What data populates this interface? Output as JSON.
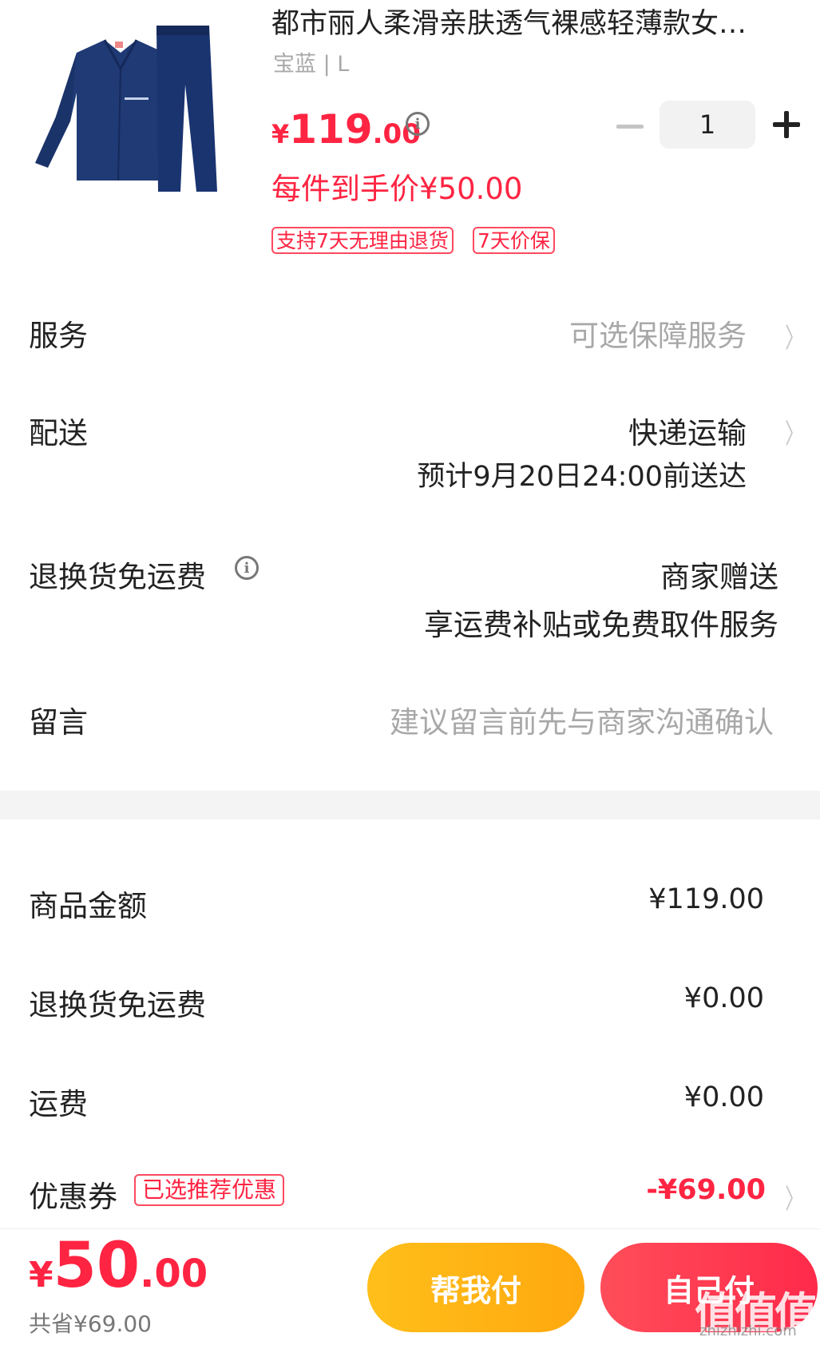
{
  "product": {
    "title": "都市丽人柔滑亲肤透气裸感轻薄款女…",
    "variant": "宝蓝 | L",
    "price_symbol": "¥",
    "price_int": "119",
    "price_dec": ".00",
    "per_unit": "每件到手价¥50.00",
    "quantity": "1",
    "tags": [
      "支持7天无理由退货",
      "7天价保"
    ],
    "image_colors": {
      "garment": "#1f3a75",
      "garment_dark": "#15295a",
      "trim": "#c7d3ea"
    }
  },
  "rows": {
    "service": {
      "label": "服务",
      "value": "可选保障服务"
    },
    "delivery": {
      "label": "配送",
      "value": "快递运输",
      "sub": "预计9月20日24:00前送达"
    },
    "return_free": {
      "label": "退换货免运费",
      "value": "商家赠送",
      "sub": "享运费补贴或免费取件服务"
    },
    "message": {
      "label": "留言",
      "placeholder": "建议留言前先与商家沟通确认"
    }
  },
  "summary": {
    "goods": {
      "label": "商品金额",
      "amount": "¥119.00"
    },
    "return_free": {
      "label": "退换货免运费",
      "amount": "¥0.00"
    },
    "shipping": {
      "label": "运费",
      "amount": "¥0.00"
    },
    "coupon": {
      "label": "优惠券",
      "tag": "已选推荐优惠",
      "amount": "-¥69.00"
    }
  },
  "bottom": {
    "total_symbol": "¥",
    "total_int": "50",
    "total_dec": ".00",
    "saved": "共省¥69.00",
    "help_pay": "帮我付",
    "self_pay": "自己付"
  },
  "watermark": {
    "main": "值值值",
    "url": "zhizhizhi.com"
  },
  "colors": {
    "accent": "#ff2442",
    "help_button": "#ffb414",
    "self_button": "#ff3a50"
  },
  "icons": [
    "info-icon",
    "minus-icon",
    "plus-icon",
    "chevron-right-icon"
  ]
}
